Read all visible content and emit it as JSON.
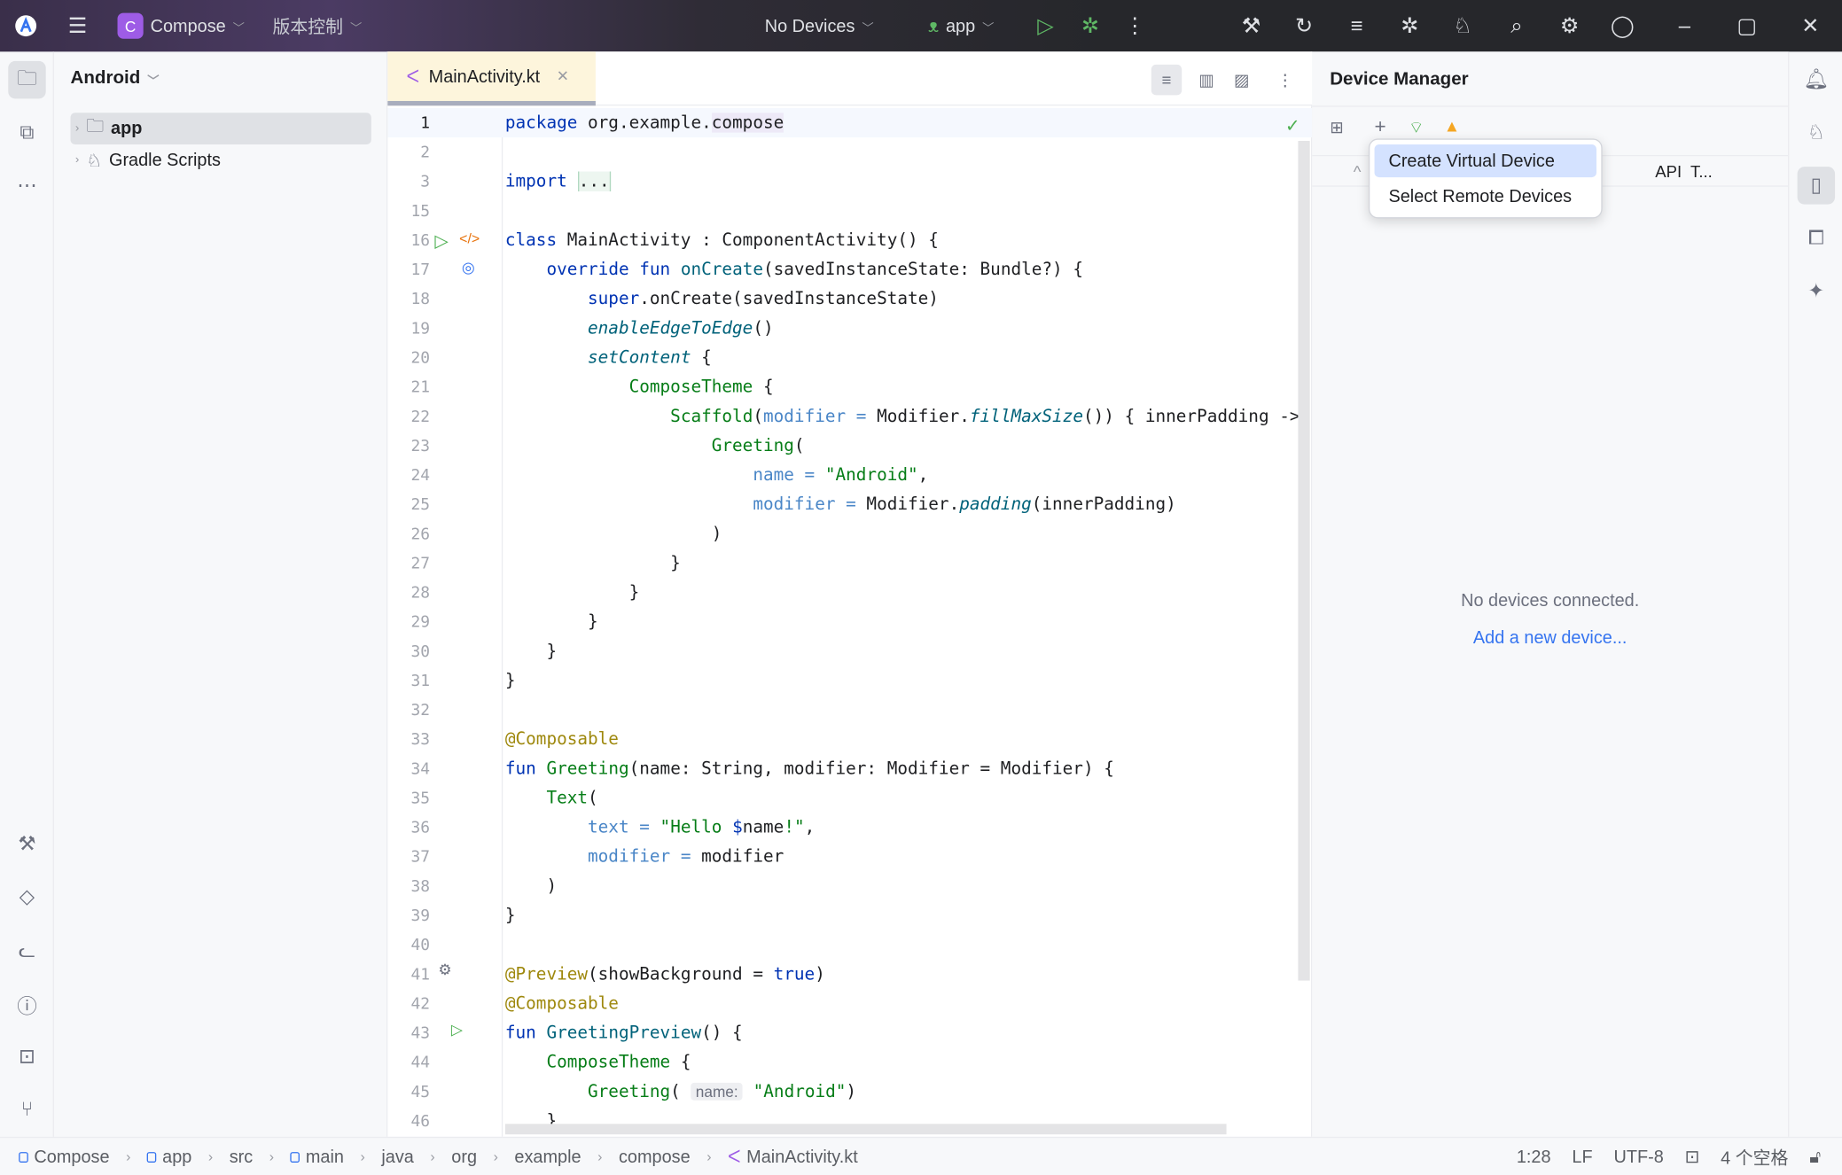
{
  "titlebar": {
    "project_badge": "C",
    "project": "Compose",
    "vcs": "版本控制",
    "devices": "No Devices",
    "run_config": "app"
  },
  "project_panel": {
    "view": "Android",
    "items": [
      {
        "label": "app"
      },
      {
        "label": "Gradle Scripts"
      }
    ]
  },
  "editor": {
    "tab": "MainActivity.kt",
    "lines": [
      {
        "n": "1",
        "t": [
          [
            "k",
            "package "
          ],
          [
            "n",
            "org.example."
          ],
          [
            "hl",
            "compose"
          ]
        ]
      },
      {
        "n": "2",
        "t": []
      },
      {
        "n": "3",
        "t": [
          [
            "k",
            "import "
          ],
          [
            "fold",
            "..."
          ]
        ]
      },
      {
        "n": "15",
        "t": []
      },
      {
        "n": "16",
        "t": [
          [
            "k",
            "class "
          ],
          [
            "n",
            "MainActivity : ComponentActivity() {"
          ]
        ]
      },
      {
        "n": "17",
        "t": [
          [
            "n",
            "    "
          ],
          [
            "k",
            "override fun "
          ],
          [
            "f",
            "onCreate"
          ],
          [
            "n",
            "(savedInstanceState: Bundle?) {"
          ]
        ]
      },
      {
        "n": "18",
        "t": [
          [
            "n",
            "        "
          ],
          [
            "k",
            "super"
          ],
          [
            "n",
            ".onCreate(savedInstanceState)"
          ]
        ]
      },
      {
        "n": "19",
        "t": [
          [
            "n",
            "        "
          ],
          [
            "fi",
            "enableEdgeToEdge"
          ],
          [
            "n",
            "()"
          ]
        ]
      },
      {
        "n": "20",
        "t": [
          [
            "n",
            "        "
          ],
          [
            "fi",
            "setContent"
          ],
          [
            "n",
            " {"
          ]
        ]
      },
      {
        "n": "21",
        "t": [
          [
            "n",
            "            "
          ],
          [
            "c",
            "ComposeTheme"
          ],
          [
            "n",
            " {"
          ]
        ]
      },
      {
        "n": "22",
        "t": [
          [
            "n",
            "                "
          ],
          [
            "c",
            "Scaffold"
          ],
          [
            "n",
            "("
          ],
          [
            "p",
            "modifier"
          ],
          [
            "p",
            " = "
          ],
          [
            "n",
            "Modifier."
          ],
          [
            "fi",
            "fillMaxSize"
          ],
          [
            "n",
            "()) { innerPadding ->"
          ]
        ]
      },
      {
        "n": "23",
        "t": [
          [
            "n",
            "                    "
          ],
          [
            "c",
            "Greeting"
          ],
          [
            "n",
            "("
          ]
        ]
      },
      {
        "n": "24",
        "t": [
          [
            "n",
            "                        "
          ],
          [
            "p",
            "name = "
          ],
          [
            "s",
            "\"Android\""
          ],
          [
            "n",
            ","
          ]
        ]
      },
      {
        "n": "25",
        "t": [
          [
            "n",
            "                        "
          ],
          [
            "p",
            "modifier = "
          ],
          [
            "n",
            "Modifier."
          ],
          [
            "fi",
            "padding"
          ],
          [
            "n",
            "(innerPadding)"
          ]
        ]
      },
      {
        "n": "26",
        "t": [
          [
            "n",
            "                    )"
          ]
        ]
      },
      {
        "n": "27",
        "t": [
          [
            "n",
            "                }"
          ]
        ]
      },
      {
        "n": "28",
        "t": [
          [
            "n",
            "            }"
          ]
        ]
      },
      {
        "n": "29",
        "t": [
          [
            "n",
            "        }"
          ]
        ]
      },
      {
        "n": "30",
        "t": [
          [
            "n",
            "    }"
          ]
        ]
      },
      {
        "n": "31",
        "t": [
          [
            "n",
            "}"
          ]
        ]
      },
      {
        "n": "32",
        "t": []
      },
      {
        "n": "33",
        "t": [
          [
            "a",
            "@Composable"
          ]
        ]
      },
      {
        "n": "34",
        "t": [
          [
            "k",
            "fun "
          ],
          [
            "c",
            "Greeting"
          ],
          [
            "n",
            "(name: String, modifier: Modifier = Modifier) {"
          ]
        ]
      },
      {
        "n": "35",
        "t": [
          [
            "n",
            "    "
          ],
          [
            "c",
            "Text"
          ],
          [
            "n",
            "("
          ]
        ]
      },
      {
        "n": "36",
        "t": [
          [
            "n",
            "        "
          ],
          [
            "p",
            "text = "
          ],
          [
            "s",
            "\"Hello "
          ],
          [
            "k",
            "$"
          ],
          [
            "n",
            "name"
          ],
          [
            "s",
            "!\""
          ],
          [
            "n",
            ","
          ]
        ]
      },
      {
        "n": "37",
        "t": [
          [
            "n",
            "        "
          ],
          [
            "p",
            "modifier = "
          ],
          [
            "n",
            "modifier"
          ]
        ]
      },
      {
        "n": "38",
        "t": [
          [
            "n",
            "    )"
          ]
        ]
      },
      {
        "n": "39",
        "t": [
          [
            "n",
            "}"
          ]
        ]
      },
      {
        "n": "40",
        "t": []
      },
      {
        "n": "41",
        "t": [
          [
            "a",
            "@Preview"
          ],
          [
            "n",
            "(showBackground = "
          ],
          [
            "k",
            "true"
          ],
          [
            "n",
            ")"
          ]
        ]
      },
      {
        "n": "42",
        "t": [
          [
            "a",
            "@Composable"
          ]
        ]
      },
      {
        "n": "43",
        "t": [
          [
            "k",
            "fun "
          ],
          [
            "f",
            "GreetingPreview"
          ],
          [
            "n",
            "() {"
          ]
        ]
      },
      {
        "n": "44",
        "t": [
          [
            "n",
            "    "
          ],
          [
            "c",
            "ComposeTheme"
          ],
          [
            "n",
            " {"
          ]
        ]
      },
      {
        "n": "45",
        "t": [
          [
            "n",
            "        "
          ],
          [
            "c",
            "Greeting"
          ],
          [
            "n",
            "( "
          ],
          [
            "hint",
            "name:"
          ],
          [
            "n",
            " "
          ],
          [
            "s",
            "\"Android\""
          ],
          [
            "n",
            ")"
          ]
        ]
      },
      {
        "n": "46",
        "t": [
          [
            "n",
            "    }"
          ]
        ]
      }
    ]
  },
  "device_manager": {
    "title": "Device Manager",
    "columns": [
      "API",
      "T..."
    ],
    "empty": "No devices connected.",
    "link": "Add a new device...",
    "menu": [
      {
        "label": "Create Virtual Device",
        "selected": true
      },
      {
        "label": "Select Remote Devices",
        "selected": false
      }
    ]
  },
  "status": {
    "breadcrumbs": [
      "Compose",
      "app",
      "src",
      "main",
      "java",
      "org",
      "example",
      "compose",
      "MainActivity.kt"
    ],
    "position": "1:28",
    "line_sep": "LF",
    "encoding": "UTF-8",
    "indent": "4 个空格"
  },
  "colors": {
    "keyword": "#0033b3",
    "string": "#067d17",
    "param": "#4a86c7",
    "annotation": "#9e880d",
    "accent": "#3574f0",
    "badge": "#9e5ce6"
  }
}
